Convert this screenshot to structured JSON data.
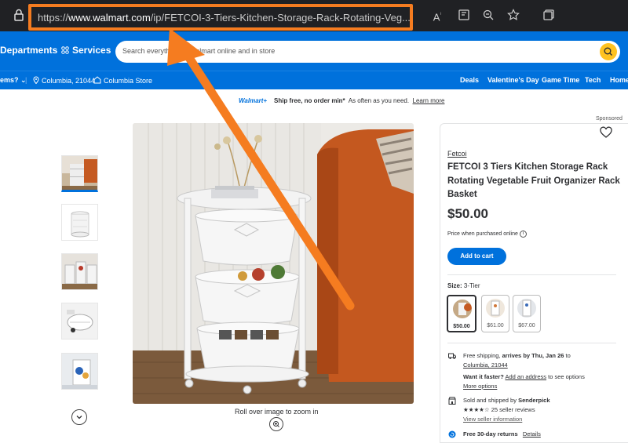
{
  "browser": {
    "url_prefix": "https://",
    "url_domain": "www.walmart.com",
    "url_path": "/ip/FETCOI-3-Tiers-Kitchen-Storage-Rack-Rotating-Veg..."
  },
  "header": {
    "departments": "Departments",
    "services": "Services",
    "search_placeholder": "Search everything at Walmart online and in store"
  },
  "subnav": {
    "items_left": "ems?",
    "location": "Columbia, 21044",
    "store": "Columbia Store",
    "links": [
      "Deals",
      "Valentine's Day",
      "Game Time",
      "Tech",
      "Home"
    ]
  },
  "promo": {
    "badge": "Walmart+",
    "bold": "Ship free, no order min*",
    "text": "As often as you need.",
    "link": "Learn more"
  },
  "gallery": {
    "zoom_label": "Roll over image to zoom in"
  },
  "product": {
    "sponsored": "Sponsored",
    "brand": "Fetcoi",
    "title": "FETCOI 3 Tiers Kitchen Storage Rack Rotating Vegetable Fruit Organizer Rack Basket",
    "price": "$50.00",
    "price_note": "Price when purchased online",
    "add_to_cart": "Add to cart",
    "size_label": "Size:",
    "size_value": "3-Tier",
    "options": [
      {
        "price": "$50.00"
      },
      {
        "price": "$61.00"
      },
      {
        "price": "$67.00"
      }
    ],
    "shipping_text": "Free shipping,",
    "shipping_bold": "arrives by Thu, Jan 26",
    "shipping_to": "to",
    "shipping_location": "Columbia, 21044",
    "faster_bold": "Want it faster?",
    "faster_link": "Add an address",
    "faster_text": "to see options",
    "more_options": "More options",
    "seller_text": "Sold and shipped by",
    "seller_name": "Senderpick",
    "stars": "★★★★☆",
    "reviews": "25 seller reviews",
    "view_seller": "View seller information",
    "returns_bold": "Free 30-day returns",
    "returns_link": "Details"
  },
  "colors": {
    "walmart_blue": "#0071dc",
    "spark_yellow": "#ffc220",
    "annotation_orange": "#f57c20"
  }
}
